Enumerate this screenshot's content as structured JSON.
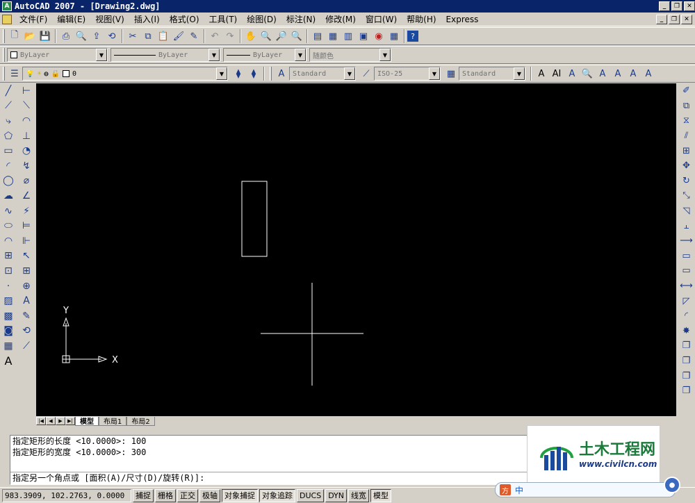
{
  "window": {
    "title": "AutoCAD 2007 - [Drawing2.dwg]",
    "app_icon": "A"
  },
  "menus": [
    "文件(F)",
    "编辑(E)",
    "视图(V)",
    "插入(I)",
    "格式(O)",
    "工具(T)",
    "绘图(D)",
    "标注(N)",
    "修改(M)",
    "窗口(W)",
    "帮助(H)",
    "Express"
  ],
  "properties": {
    "color": "ByLayer",
    "linetype": "ByLayer",
    "lineweight": "ByLayer",
    "plotstyle": "随颜色"
  },
  "layer": {
    "current": "0"
  },
  "styles": {
    "text": "Standard",
    "dimension": "ISO-25",
    "table": "Standard"
  },
  "layout_tabs": [
    "模型",
    "布局1",
    "布局2"
  ],
  "ucs": {
    "x_label": "X",
    "y_label": "Y"
  },
  "command": {
    "history": [
      "指定矩形的长度 <10.0000>: 100",
      "指定矩形的宽度 <10.0000>: 300"
    ],
    "prompt": "指定另一个角点或 [面积(A)/尺寸(D)/旋转(R)]:"
  },
  "status": {
    "coordinates": "983.3909, 102.2763, 0.0000",
    "buttons": [
      "捕捉",
      "栅格",
      "正交",
      "极轴",
      "对象捕捉",
      "对象追踪",
      "DUCS",
      "DYN",
      "线宽",
      "模型"
    ]
  },
  "watermark": {
    "name": "土木工程网",
    "url": "www.civilcn.com"
  },
  "ime": {
    "label": "中"
  }
}
